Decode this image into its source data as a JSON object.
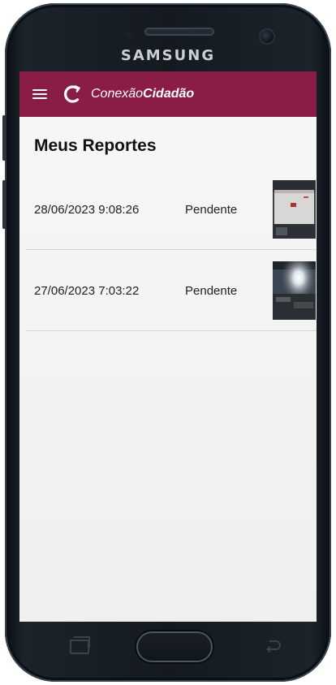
{
  "device": {
    "brand": "SAMSUNG"
  },
  "app_bar": {
    "menu_icon": "hamburger-menu-icon",
    "logo_icon": "refresh-ring-logo-icon",
    "title_light": "Conexão",
    "title_bold": "Cidadão",
    "background": "#8a1d45"
  },
  "page": {
    "title": "Meus Reportes"
  },
  "reports": [
    {
      "date": "28/06/2023 9:08:26",
      "status": "Pendente",
      "thumbnail": "photo-thumbnail"
    },
    {
      "date": "27/06/2023 7:03:22",
      "status": "Pendente",
      "thumbnail": "photo-thumbnail"
    }
  ],
  "nav": {
    "recent_icon": "recent-apps-icon",
    "home_icon": "home-button",
    "back_icon": "back-arrow-icon"
  }
}
